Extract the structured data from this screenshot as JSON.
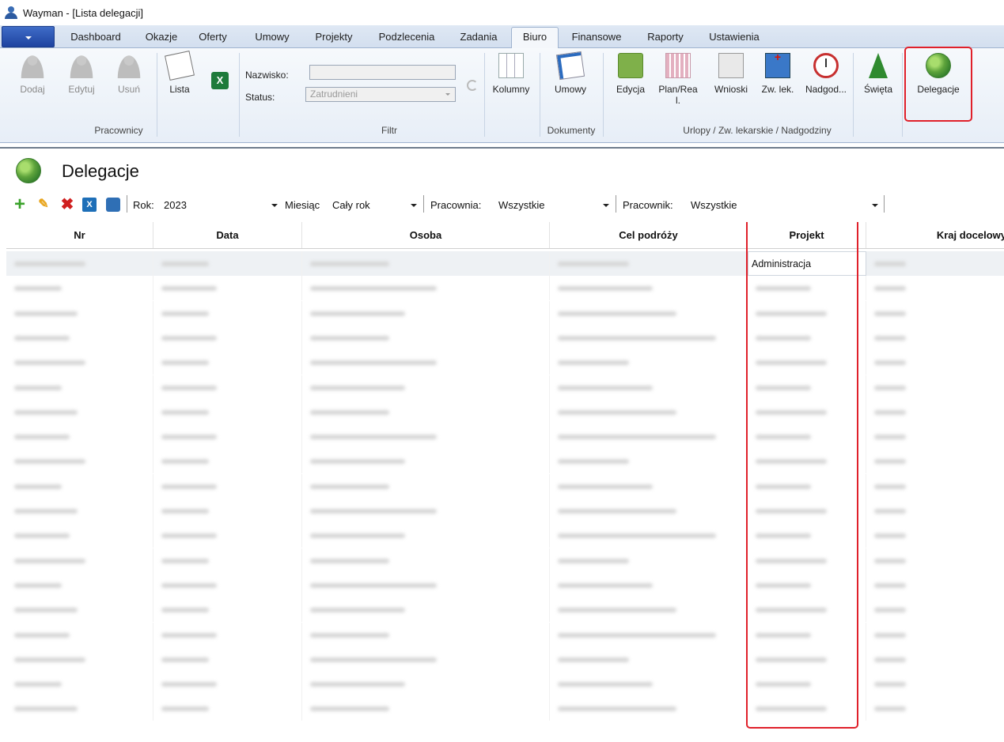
{
  "window": {
    "title": "Wayman - [Lista delegacji]"
  },
  "tabs": [
    {
      "label": "Dashboard"
    },
    {
      "label": "Okazje"
    },
    {
      "label": "Oferty"
    },
    {
      "label": "Umowy"
    },
    {
      "label": "Projekty"
    },
    {
      "label": "Podzlecenia"
    },
    {
      "label": "Zadania"
    },
    {
      "label": "Biuro"
    },
    {
      "label": "Finansowe"
    },
    {
      "label": "Raporty"
    },
    {
      "label": "Ustawienia"
    }
  ],
  "active_tab": "Biuro",
  "ribbon": {
    "pracownicy": {
      "group_label": "Pracownicy",
      "dodaj": "Dodaj",
      "edytuj": "Edytuj",
      "usun": "Usuń",
      "lista": "Lista"
    },
    "filtr": {
      "group_label": "Filtr",
      "nazwisko_label": "Nazwisko:",
      "nazwisko_value": "",
      "status_label": "Status:",
      "status_value": "Zatrudnieni",
      "kolumny": "Kolumny"
    },
    "dokumenty": {
      "group_label": "Dokumenty",
      "umowy": "Umowy"
    },
    "urlopy": {
      "group_label": "Urlopy / Zw. lekarskie / Nadgodziny",
      "edycja": "Edycja",
      "plan_line1": "Plan/Rea",
      "plan_line2": "l.",
      "wnioski": "Wnioski",
      "zw_lek": "Zw. lek.",
      "nadgod": "Nadgod..."
    },
    "swieta": "Święta",
    "delegacje": "Delegacje",
    "highlight_color": "#e0202a"
  },
  "page": {
    "title": "Delegacje"
  },
  "toolbar": {
    "rok_label": "Rok:",
    "rok_value": "2023",
    "miesiac_label": "Miesiąc",
    "miesiac_value": "Cały rok",
    "pracownia_label": "Pracownia:",
    "pracownia_value": "Wszystkie",
    "pracownik_label": "Pracownik:",
    "pracownik_value": "Wszystkie",
    "icons": [
      "add-icon",
      "edit-icon",
      "delete-icon",
      "excel-export-icon",
      "print-icon"
    ]
  },
  "table": {
    "columns": [
      "Nr",
      "Data",
      "Osoba",
      "Cel podróży",
      "Projekt",
      "Kraj docelowy"
    ],
    "first_row_projekt": "Administracja",
    "row_count_visible": 19
  }
}
